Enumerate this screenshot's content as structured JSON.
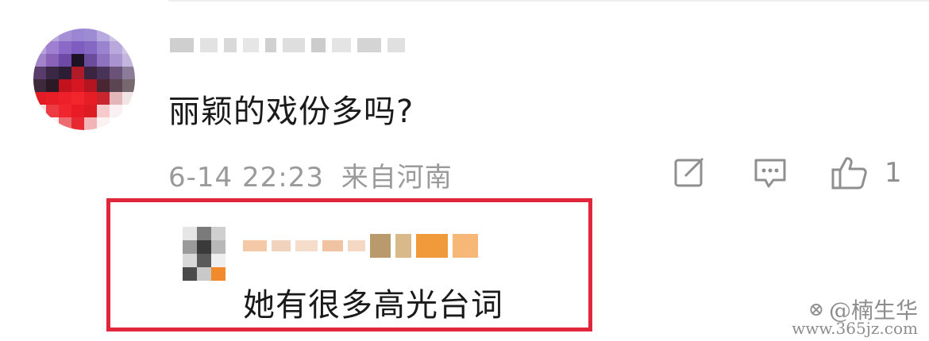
{
  "comment": {
    "text": "丽颖的戏份多吗?",
    "date": "6-14 22:23",
    "location": "来自河南",
    "like_count": "1"
  },
  "reply": {
    "text": "她有很多高光台词"
  },
  "watermark": {
    "handle": "@楠生华",
    "logo": "⊗",
    "url": "www.365jz.com"
  },
  "icons": {
    "share": "share-edit-icon",
    "reply": "comment-bubble-icon",
    "like": "thumbs-up-icon"
  },
  "colors": {
    "highlight_border": "#e0263a",
    "meta_text": "#9a9a9a",
    "body_text": "#1a1a1a"
  }
}
